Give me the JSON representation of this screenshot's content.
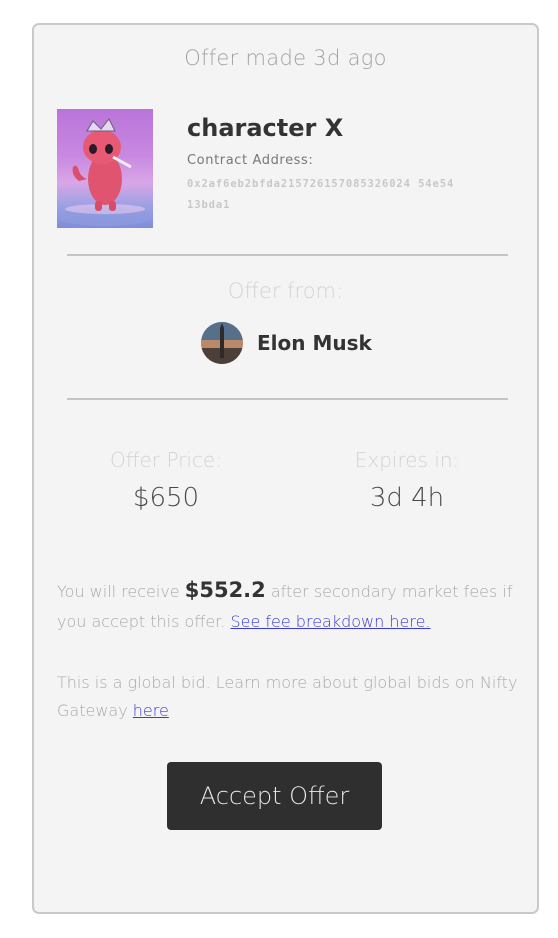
{
  "card": {
    "offer_made": "Offer made 3d ago",
    "nft": {
      "title": "character X",
      "contract_label": "Contract Address:",
      "contract_address": "0x2af6eb2bfda215726157085326024 54e5413bda1"
    },
    "offer_from": {
      "label": "Offer from:",
      "user_name": "Elon Musk"
    },
    "offer_price": {
      "label": "Offer Price:",
      "value": "$650"
    },
    "expires": {
      "label": "Expires in:",
      "value": "3d 4h"
    },
    "receive": {
      "prefix": "You will receive",
      "amount": "$552.2",
      "suffix": "after secondary market fees if you accept this offer.",
      "link": "See fee breakdown here."
    },
    "global_bid": {
      "text": "This is a global bid. Learn more about global bids on Nifty Gateway",
      "link": "here"
    },
    "accept_button": "Accept Offer"
  },
  "colors": {
    "card_background": "#f4f4f4",
    "card_border": "#c9c9c9",
    "link": "#3b3bd6",
    "button_background": "#2f2f2f"
  },
  "icons": {
    "nft_thumbnail": "pink-character-image",
    "avatar": "user-avatar-image"
  }
}
